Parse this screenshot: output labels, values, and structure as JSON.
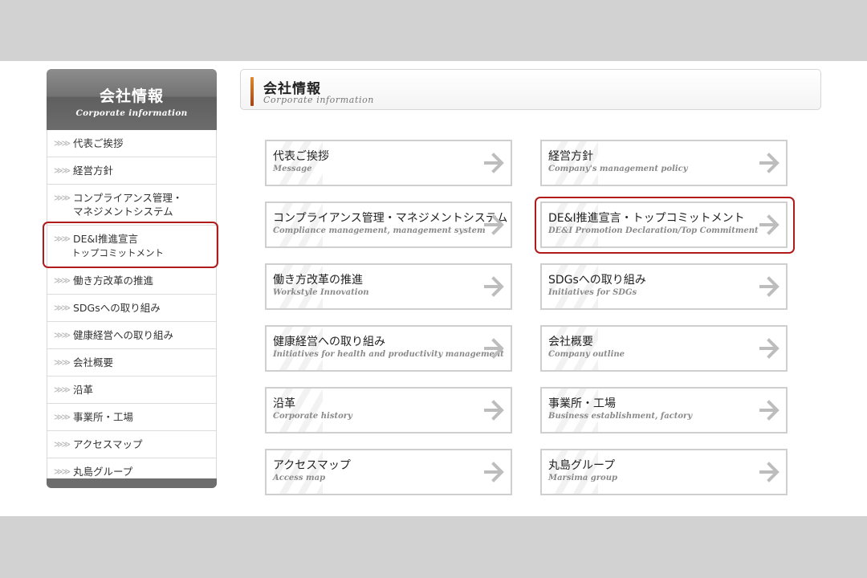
{
  "sidebar": {
    "title": "会社情報",
    "subtitle": "Corporate information",
    "items": [
      {
        "label": "代表ご挨拶"
      },
      {
        "label": "経営方針"
      },
      {
        "label": "コンプライアンス管理・",
        "label2": "マネジメントシステム"
      },
      {
        "label": "DE&I推進宣言",
        "label2": "トップコミットメント"
      },
      {
        "label": "働き方改革の推進"
      },
      {
        "label": "SDGsへの取り組み"
      },
      {
        "label": "健康経営への取り組み"
      },
      {
        "label": "会社概要"
      },
      {
        "label": "沿革"
      },
      {
        "label": "事業所・工場"
      },
      {
        "label": "アクセスマップ"
      },
      {
        "label": "丸島グループ"
      }
    ],
    "chevron": "≫≫"
  },
  "header": {
    "title": "会社情報",
    "subtitle": "Corporate information"
  },
  "cards": [
    {
      "title": "代表ご挨拶",
      "subtitle": "Message"
    },
    {
      "title": "経営方針",
      "subtitle": "Company's management policy"
    },
    {
      "title": "コンプライアンス管理・マネジメントシステム",
      "subtitle": "Compliance management, management system"
    },
    {
      "title": "DE&I推進宣言・トップコミットメント",
      "subtitle": "DE&I Promotion Declaration/Top Commitment"
    },
    {
      "title": "働き方改革の推進",
      "subtitle": "Workstyle Innovation"
    },
    {
      "title": "SDGsへの取り組み",
      "subtitle": "Initiatives for SDGs"
    },
    {
      "title": "健康経営への取り組み",
      "subtitle": "Initiatives for health and productivity management"
    },
    {
      "title": "会社概要",
      "subtitle": "Company outline"
    },
    {
      "title": "沿革",
      "subtitle": "Corporate history"
    },
    {
      "title": "事業所・工場",
      "subtitle": "Business establishment, factory"
    },
    {
      "title": "アクセスマップ",
      "subtitle": "Access map"
    },
    {
      "title": "丸島グループ",
      "subtitle": "Marsima group"
    }
  ],
  "colors": {
    "highlight": "#b11b1b",
    "accent": "#e08a2c",
    "arrow": "#bdbdbd"
  },
  "icons": {
    "card_arrow": "right-arrow-icon",
    "sidebar_chevron": "triple-chevron-icon"
  }
}
